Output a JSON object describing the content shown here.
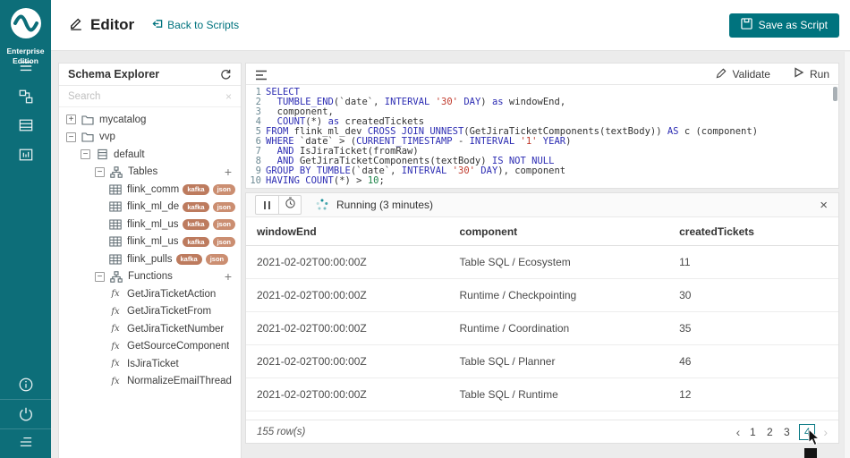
{
  "colors": {
    "sidebar": "#0d6e79",
    "accent": "#00737e",
    "keyword": "#2d2db3",
    "string": "#c0392b",
    "number": "#1e8449",
    "badge_kafka": "#bd7b5e",
    "badge_json": "#cb8e71"
  },
  "sidebar": {
    "brand_line1": "Enterprise",
    "brand_line2": "Edition",
    "nav_icons": [
      "menu",
      "deployments",
      "table-list",
      "dashboard"
    ],
    "footer_icons": [
      "info",
      "power",
      "list-indent"
    ]
  },
  "header": {
    "title": "Editor",
    "back_link": "Back to Scripts",
    "save_button": "Save as Script"
  },
  "schema_explorer": {
    "title": "Schema Explorer",
    "search_placeholder": "Search",
    "tree": [
      {
        "label": "mycatalog",
        "icon": "folder",
        "indent": 0,
        "expanded": false
      },
      {
        "label": "vvp",
        "icon": "folder",
        "indent": 0,
        "expanded": true
      },
      {
        "label": "default",
        "icon": "db",
        "indent": 1,
        "expanded": true
      },
      {
        "label": "Tables",
        "icon": "sitemap",
        "indent": 2,
        "expanded": true,
        "add": true
      },
      {
        "label": "flink_commits",
        "icon": "table",
        "indent": 3,
        "badges": [
          "kafka",
          "json"
        ]
      },
      {
        "label": "flink_ml_dev",
        "icon": "table",
        "indent": 3,
        "badges": [
          "kafka",
          "json"
        ]
      },
      {
        "label": "flink_ml_user",
        "icon": "table",
        "indent": 3,
        "badges": [
          "kafka",
          "json"
        ]
      },
      {
        "label": "flink_ml_user_zh",
        "icon": "table",
        "indent": 3,
        "badges": [
          "kafka",
          "json"
        ]
      },
      {
        "label": "flink_pulls",
        "icon": "table",
        "indent": 3,
        "badges": [
          "kafka",
          "json"
        ]
      },
      {
        "label": "Functions",
        "icon": "sitemap",
        "indent": 2,
        "expanded": true,
        "add": true
      },
      {
        "label": "GetJiraTicketAction",
        "icon": "fx",
        "indent": 3
      },
      {
        "label": "GetJiraTicketFrom",
        "icon": "fx",
        "indent": 3
      },
      {
        "label": "GetJiraTicketNumber",
        "icon": "fx",
        "indent": 3
      },
      {
        "label": "GetSourceComponent",
        "icon": "fx",
        "indent": 3
      },
      {
        "label": "IsJiraTicket",
        "icon": "fx",
        "indent": 3
      },
      {
        "label": "NormalizeEmailThread",
        "icon": "fx",
        "indent": 3
      }
    ]
  },
  "editor": {
    "validate_label": "Validate",
    "run_label": "Run",
    "code_lines": [
      [
        [
          "SELECT",
          "k"
        ]
      ],
      [
        [
          "  ",
          "d"
        ],
        [
          "TUMBLE_END",
          "k"
        ],
        [
          "(",
          "d"
        ],
        [
          "`date`",
          "d"
        ],
        [
          ", ",
          "d"
        ],
        [
          "INTERVAL",
          "k"
        ],
        [
          " ",
          "d"
        ],
        [
          "'30'",
          "s"
        ],
        [
          " ",
          "d"
        ],
        [
          "DAY",
          "k"
        ],
        [
          ") ",
          "d"
        ],
        [
          "as",
          "k"
        ],
        [
          " windowEnd,",
          "d"
        ]
      ],
      [
        [
          "  component,",
          "d"
        ]
      ],
      [
        [
          "  ",
          "d"
        ],
        [
          "COUNT",
          "k"
        ],
        [
          "(*) ",
          "d"
        ],
        [
          "as",
          "k"
        ],
        [
          " createdTickets",
          "d"
        ]
      ],
      [
        [
          "FROM",
          "k"
        ],
        [
          " flink_ml_dev ",
          "d"
        ],
        [
          "CROSS JOIN UNNEST",
          "k"
        ],
        [
          "(GetJiraTicketComponents(textBody)) ",
          "d"
        ],
        [
          "AS",
          "k"
        ],
        [
          " c (component)",
          "d"
        ]
      ],
      [
        [
          "WHERE",
          "k"
        ],
        [
          " `date` > (",
          "d"
        ],
        [
          "CURRENT_TIMESTAMP",
          "k"
        ],
        [
          " - ",
          "d"
        ],
        [
          "INTERVAL",
          "k"
        ],
        [
          " ",
          "d"
        ],
        [
          "'1'",
          "s"
        ],
        [
          " ",
          "d"
        ],
        [
          "YEAR",
          "k"
        ],
        [
          ")",
          "d"
        ]
      ],
      [
        [
          "  ",
          "d"
        ],
        [
          "AND",
          "k"
        ],
        [
          " IsJiraTicket(fromRaw)",
          "d"
        ]
      ],
      [
        [
          "  ",
          "d"
        ],
        [
          "AND",
          "k"
        ],
        [
          " GetJiraTicketComponents(textBody) ",
          "d"
        ],
        [
          "IS NOT NULL",
          "k"
        ]
      ],
      [
        [
          "GROUP BY",
          "k"
        ],
        [
          " ",
          "d"
        ],
        [
          "TUMBLE",
          "k"
        ],
        [
          "(",
          "d"
        ],
        [
          "`date`",
          "d"
        ],
        [
          ", ",
          "d"
        ],
        [
          "INTERVAL",
          "k"
        ],
        [
          " ",
          "d"
        ],
        [
          "'30'",
          "s"
        ],
        [
          " ",
          "d"
        ],
        [
          "DAY",
          "k"
        ],
        [
          "), component",
          "d"
        ]
      ],
      [
        [
          "HAVING",
          "k"
        ],
        [
          " ",
          "d"
        ],
        [
          "COUNT",
          "k"
        ],
        [
          "(*) > ",
          "d"
        ],
        [
          "10",
          "n"
        ],
        [
          ";",
          "d"
        ]
      ]
    ]
  },
  "results": {
    "status": "Running (3 minutes)",
    "columns": [
      "windowEnd",
      "component",
      "createdTickets"
    ],
    "rows": [
      [
        "2021-02-02T00:00:00Z",
        "Table SQL / Ecosystem",
        "11"
      ],
      [
        "2021-02-02T00:00:00Z",
        "Runtime / Checkpointing",
        "30"
      ],
      [
        "2021-02-02T00:00:00Z",
        "Runtime / Coordination",
        "35"
      ],
      [
        "2021-02-02T00:00:00Z",
        "Table SQL / Planner",
        "46"
      ],
      [
        "2021-02-02T00:00:00Z",
        "Table SQL / Runtime",
        "12"
      ]
    ],
    "row_count": "155 row(s)",
    "pagination": {
      "pages": [
        "1",
        "2",
        "3",
        "4"
      ],
      "current": "4"
    }
  }
}
